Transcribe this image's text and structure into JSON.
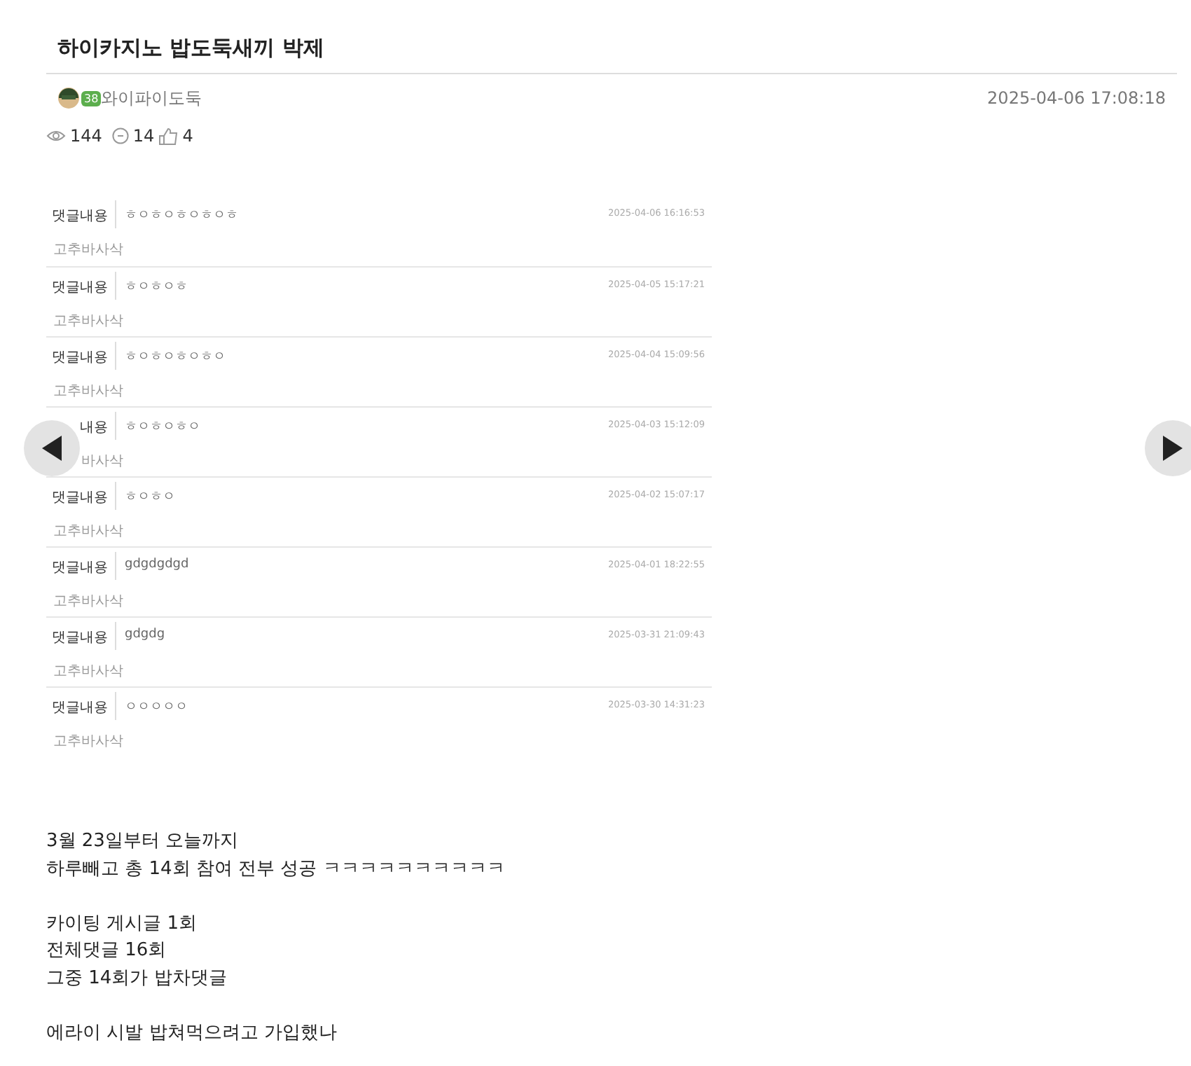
{
  "post": {
    "title": "하이카지노 밥도둑새끼 박제",
    "author": "와이파이도둑",
    "level_badge": "38",
    "date": "2025-04-06 17:08:18",
    "stats": {
      "views": "144",
      "comments": "14",
      "likes": "4"
    }
  },
  "screenshot": {
    "rows": [
      {
        "label": "댓글내용",
        "content": "ㅎㅇㅎㅇㅎㅇㅎㅇㅎ",
        "time": "2025-04-06 16:16:53",
        "author": "고추바사삭"
      },
      {
        "label": "댓글내용",
        "content": "ㅎㅇㅎㅇㅎ",
        "time": "2025-04-05 15:17:21",
        "author": "고추바사삭"
      },
      {
        "label": "댓글내용",
        "content": "ㅎㅇㅎㅇㅎㅇㅎㅇ",
        "time": "2025-04-04 15:09:56",
        "author": "고추바사삭"
      },
      {
        "label": "내용",
        "content": "ㅎㅇㅎㅇㅎㅇ",
        "time": "2025-04-03 15:12:09",
        "author": "바사삭"
      },
      {
        "label": "댓글내용",
        "content": "ㅎㅇㅎㅇ",
        "time": "2025-04-02 15:07:17",
        "author": "고추바사삭"
      },
      {
        "label": "댓글내용",
        "content": "gdgdgdgd",
        "time": "2025-04-01 18:22:55",
        "author": "고추바사삭"
      },
      {
        "label": "댓글내용",
        "content": "gdgdg",
        "time": "2025-03-31 21:09:43",
        "author": "고추바사삭"
      },
      {
        "label": "댓글내용",
        "content": "ㅇㅇㅇㅇㅇ",
        "time": "2025-03-30 14:31:23",
        "author": "고추바사삭"
      }
    ]
  },
  "body": [
    [
      "3월 23일부터 오늘까지",
      "하루빼고 총 14회 참여 전부 성공 ㅋㅋㅋㅋㅋㅋㅋㅋㅋㅋ"
    ],
    [
      "카이팅 게시글 1회",
      "전체댓글 16회",
      "그중 14회가 밥차댓글"
    ],
    [
      "에라이 시발 밥쳐먹으려고 가입했나"
    ]
  ]
}
